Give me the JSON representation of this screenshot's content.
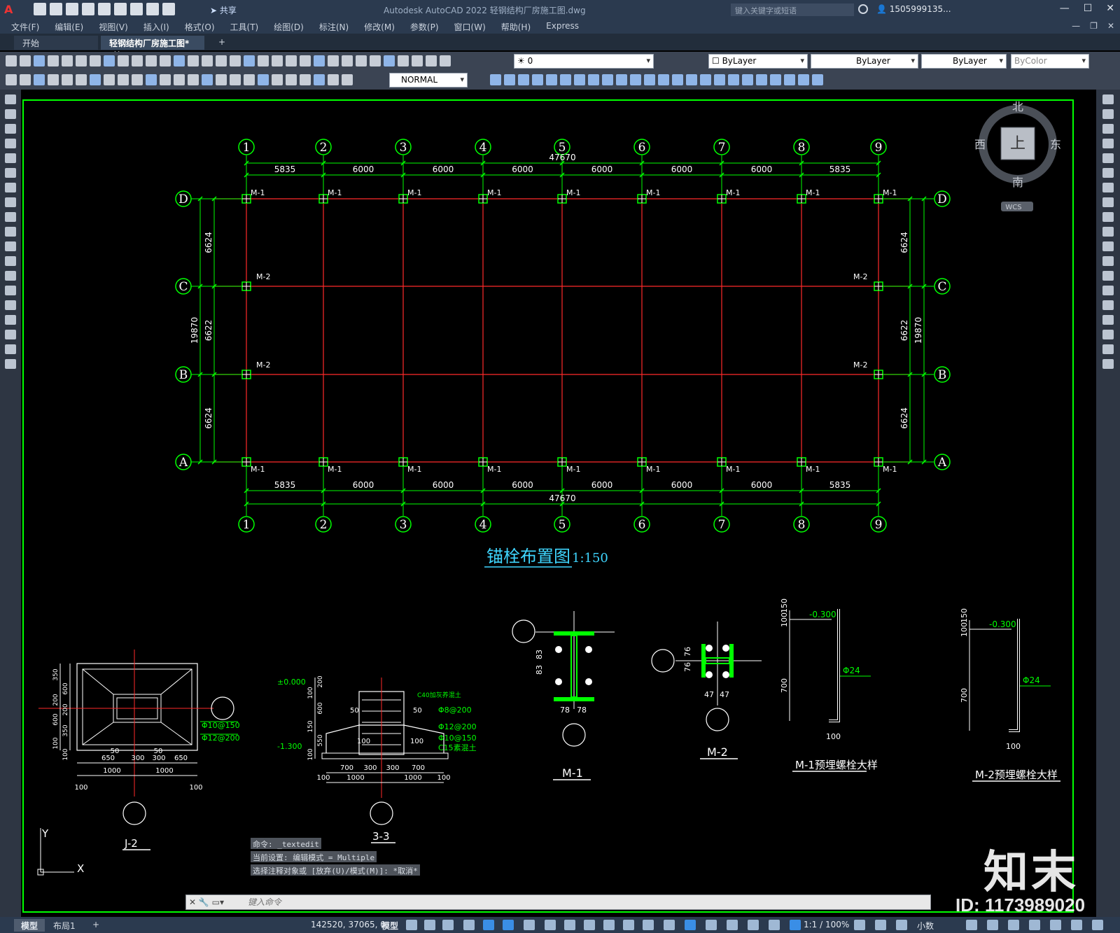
{
  "titlebar": {
    "app_logo": "A",
    "share": "共享",
    "title": "Autodesk AutoCAD 2022    轻钢结构厂房施工图.dwg",
    "search_placeholder": "键入关键字或短语",
    "user": "1505999135...",
    "minimize": "—",
    "maximize": "☐",
    "close": "✕"
  },
  "menu": {
    "items": [
      "文件(F)",
      "编辑(E)",
      "视图(V)",
      "插入(I)",
      "格式(O)",
      "工具(T)",
      "绘图(D)",
      "标注(N)",
      "修改(M)",
      "参数(P)",
      "窗口(W)",
      "帮助(H)",
      "Express"
    ]
  },
  "tabs": {
    "start": "开始",
    "drawing": "轻钢结构厂房施工图*",
    "close": "✕",
    "add": "+"
  },
  "toolbar1": {
    "layer": "0",
    "color": "ByLayer",
    "linetype": "ByLayer",
    "lineweight": "ByLayer",
    "plotstyle": "ByColor"
  },
  "toolbar2": {
    "dimstyle": "NORMAL"
  },
  "viewcube": {
    "north": "北",
    "south": "南",
    "east": "东",
    "west": "西",
    "top": "上",
    "wcs": "WCS"
  },
  "drawing": {
    "col_labels": [
      "1",
      "2",
      "3",
      "4",
      "5",
      "6",
      "7",
      "8",
      "9"
    ],
    "row_labels": [
      "D",
      "C",
      "B",
      "A"
    ],
    "spans": [
      "5835",
      "6000",
      "6000",
      "6000",
      "6000",
      "6000",
      "6000",
      "5835"
    ],
    "total_width": "47670",
    "row_spans": [
      "6624",
      "6622",
      "6624"
    ],
    "total_height": "19870",
    "anchor_m1": "M-1",
    "anchor_m2": "M-2",
    "plan_title": "锚栓布置图",
    "plan_scale": "1:150",
    "detail_j2": "J-2",
    "detail_33": "3-3",
    "detail_m1": "M-1",
    "detail_m2": "M-2",
    "detail_m1_bolt": "M-1预埋螺栓大样",
    "detail_m2_bolt": "M-2预埋螺栓大样",
    "j2_dims_top": [
      "650",
      "300",
      "300",
      "650"
    ],
    "j2_dims_bottom": [
      "1000",
      "1000"
    ],
    "j2_dims_edge": [
      "100",
      "100"
    ],
    "j2_dims_small": [
      "50",
      "50"
    ],
    "j2_left_dims": [
      "350",
      "600",
      "200",
      "200",
      "600",
      "350",
      "100",
      "100"
    ],
    "j2_rebar": [
      "Φ10@150",
      "Φ12@200"
    ],
    "s33_levels": [
      "±0.000",
      "-1.300"
    ],
    "s33_notes": [
      "C40加灰养混土",
      "Φ8@200",
      "Φ12@200",
      "Φ10@150",
      "C15素混土"
    ],
    "s33_dims_bottom": [
      "700",
      "300",
      "300",
      "700"
    ],
    "s33_dims_total": [
      "1000",
      "1000"
    ],
    "s33_dims_edge": [
      "100",
      "100"
    ],
    "s33_left_dims": [
      "200",
      "100",
      "600",
      "150",
      "550",
      "100"
    ],
    "s33_inner": [
      "50",
      "50",
      "100",
      "100"
    ],
    "m1_dims": [
      "83",
      "83",
      "78",
      "78"
    ],
    "m2_dims": [
      "76",
      "76",
      "47",
      "47"
    ],
    "bolt_level": "-0.300",
    "bolt_dims": [
      "100",
      "150",
      "700",
      "100"
    ],
    "bolt_dia": "Φ24",
    "ucs_x": "X",
    "ucs_y": "Y"
  },
  "command": {
    "history": [
      "命令: _textedit",
      "当前设置: 编辑模式 = Multiple",
      "选择注释对象或 [放弃(U)/模式(M)]: *取消*"
    ],
    "placeholder": "键入命令"
  },
  "status": {
    "tab_model": "模型",
    "tab_layout": "布局1",
    "tab_add": "+",
    "coords": "142520, 37065, 0",
    "model": "模型",
    "scale": "1:1 / 100%",
    "units": "小数"
  },
  "watermark": {
    "logo": "知末",
    "id": "ID: 1173989020"
  },
  "colors": {
    "axis_red": "#ff2a2a",
    "dim_green": "#00ff00",
    "title_cyan": "#3fd6ff",
    "detail_white": "#ffffff"
  }
}
